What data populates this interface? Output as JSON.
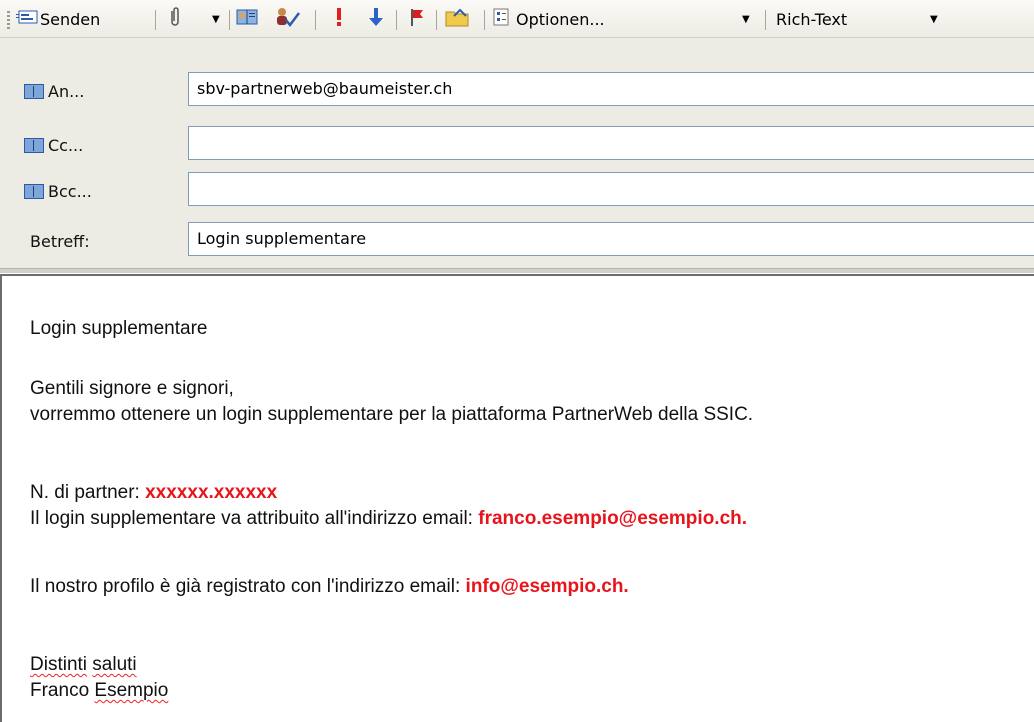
{
  "toolbar": {
    "send_label": "Senden",
    "options_label": "Optionen...",
    "format_value": "Rich-Text",
    "icons": [
      "send-icon",
      "attach-icon",
      "address-book-icon",
      "check-names-icon",
      "high-importance-icon",
      "low-importance-icon",
      "flag-icon",
      "open-folder-icon",
      "options-icon"
    ]
  },
  "header": {
    "to_label": "An...",
    "cc_label": "Cc...",
    "bcc_label": "Bcc...",
    "subject_label": "Betreff:",
    "to_value": "sbv-partnerweb@baumeister.ch",
    "cc_value": "",
    "bcc_value": "",
    "subject_value": "Login supplementare"
  },
  "body": {
    "line1": "Login supplementare",
    "line2": "Gentili signore e signori,",
    "line3": "vorremmo ottenere un login supplementare per la piattaforma PartnerWeb della SSIC.",
    "partner_label": "N. di partner: ",
    "partner_value": "xxxxxx.xxxxxx",
    "login_label": "Il login supplementare va attribuito all'indirizzo email: ",
    "login_value": "franco.esempio@esempio.ch.",
    "profile_label": "Il nostro profilo è già registrato con l'indirizzo email: ",
    "profile_value": "info@esempio.ch.",
    "closing1": "Distinti",
    "closing2": "saluti",
    "name1": "Franco",
    "name2": "Esempio"
  },
  "colors": {
    "highlight": "#e8141c",
    "toolbar_bg": "#ecebe4",
    "field_border": "#7f9db9"
  }
}
